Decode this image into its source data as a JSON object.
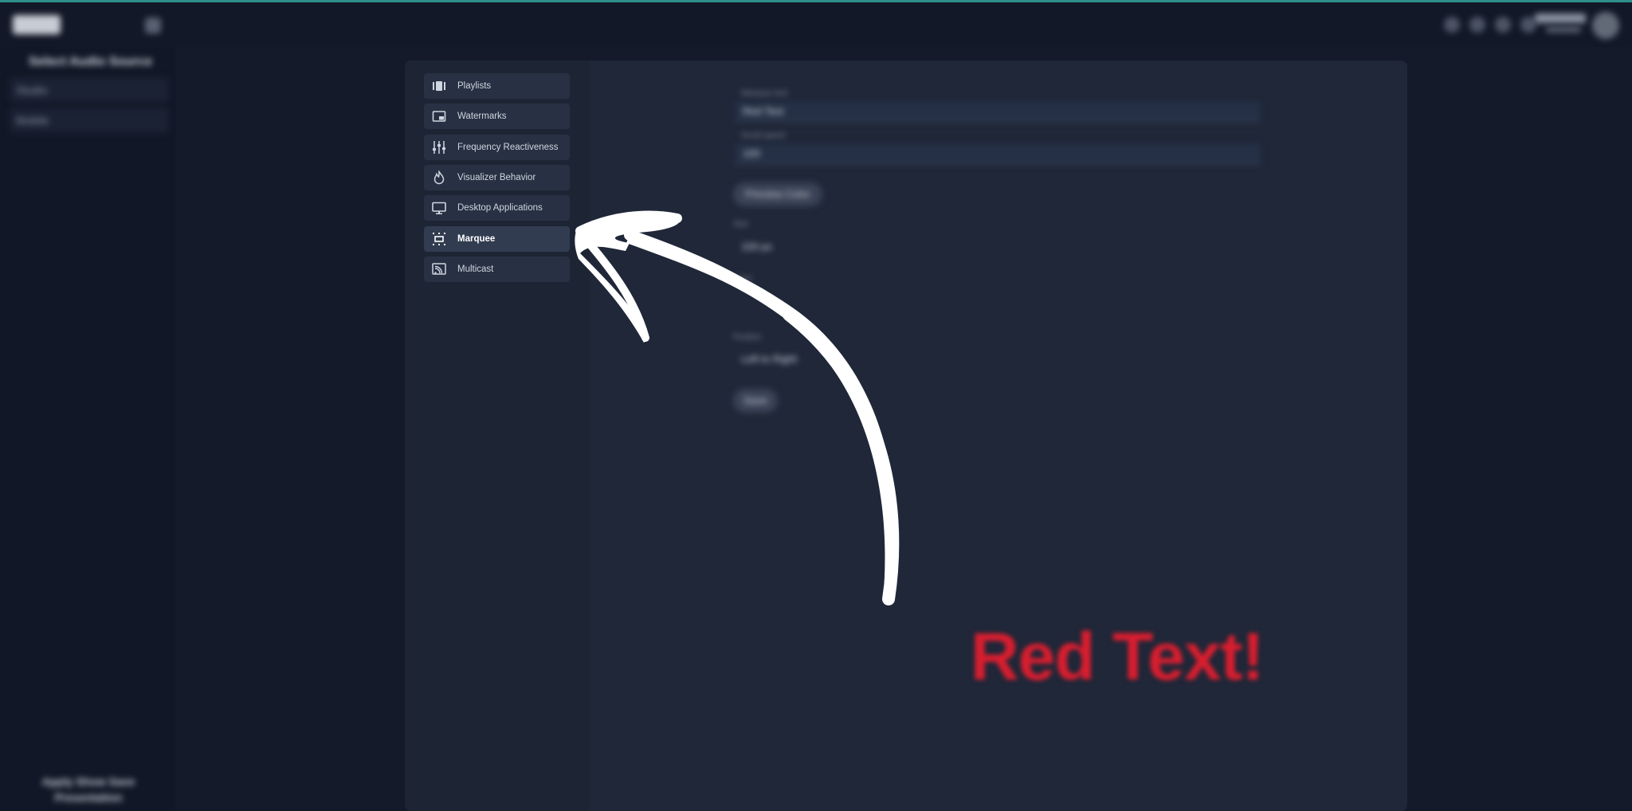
{
  "app": {
    "logo_text": "",
    "left_title": "Select Audio Source",
    "left_items": [
      "Studio",
      "Mobile"
    ],
    "left_footer": "Apply Show Save Presentation"
  },
  "settings_menu": {
    "items": [
      {
        "label": "Playlists",
        "icon": "playlist-icon",
        "active": false
      },
      {
        "label": "Watermarks",
        "icon": "watermark-icon",
        "active": false
      },
      {
        "label": "Frequency Reactiveness",
        "icon": "equalizer-icon",
        "active": false
      },
      {
        "label": "Visualizer Behavior",
        "icon": "flame-icon",
        "active": false
      },
      {
        "label": "Desktop Applications",
        "icon": "monitor-icon",
        "active": false
      },
      {
        "label": "Marquee",
        "icon": "marquee-icon",
        "active": true
      },
      {
        "label": "Multicast",
        "icon": "cast-icon",
        "active": false
      }
    ]
  },
  "marquee_form": {
    "field1_label": "Marquee text",
    "field1_value": "Red Text",
    "field2_label": "Scroll speed",
    "field2_value": "100",
    "pill_label": "Preview Color",
    "size_label": "Size",
    "size_value": "100 px",
    "color_label": "Color",
    "position_label": "Position",
    "position_value": "Left to Right",
    "save_label": "Save"
  },
  "annotation": {
    "text": "Red Text!"
  },
  "colors": {
    "annotation_red": "#d81e2f",
    "accent_teal": "#2f8f8b"
  }
}
